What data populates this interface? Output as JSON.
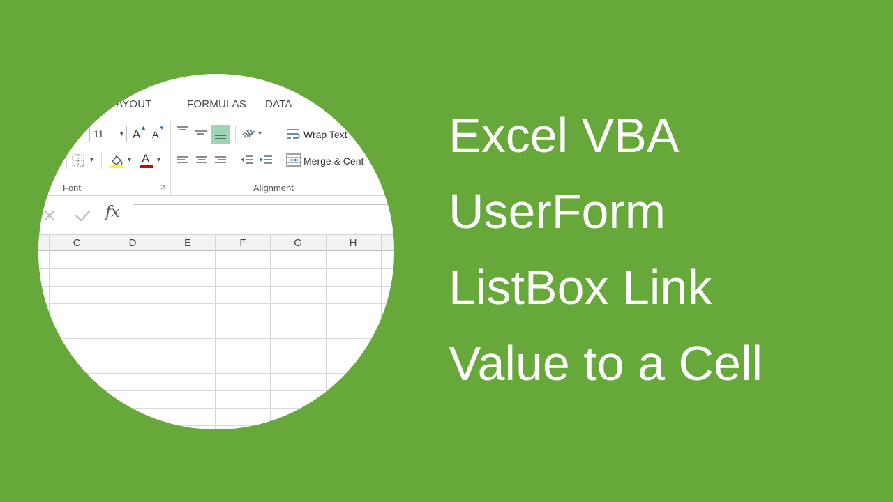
{
  "ribbon": {
    "tabs": [
      "E LAYOUT",
      "FORMULAS",
      "DATA"
    ],
    "font_size_value": "11",
    "grow_font_label": "A",
    "shrink_font_label": "A",
    "font_color_label": "A",
    "wrap_text_label": "Wrap Text",
    "merge_center_label": "Merge & Cent",
    "group_font_label": "Font",
    "group_alignment_label": "Alignment",
    "highlight_color": "#ffff00",
    "font_color": "#e00000"
  },
  "formula_bar": {
    "fx_label": "fx",
    "value": ""
  },
  "sheet": {
    "columns": [
      "C",
      "D",
      "E",
      "F",
      "G",
      "H"
    ]
  },
  "title": {
    "lines": [
      "Excel VBA",
      "UserForm",
      "ListBox Link",
      "Value to a Cell"
    ]
  },
  "colors": {
    "background": "#67a83a",
    "title_text": "#ffffff",
    "selected_align": "#9fd5b7"
  }
}
